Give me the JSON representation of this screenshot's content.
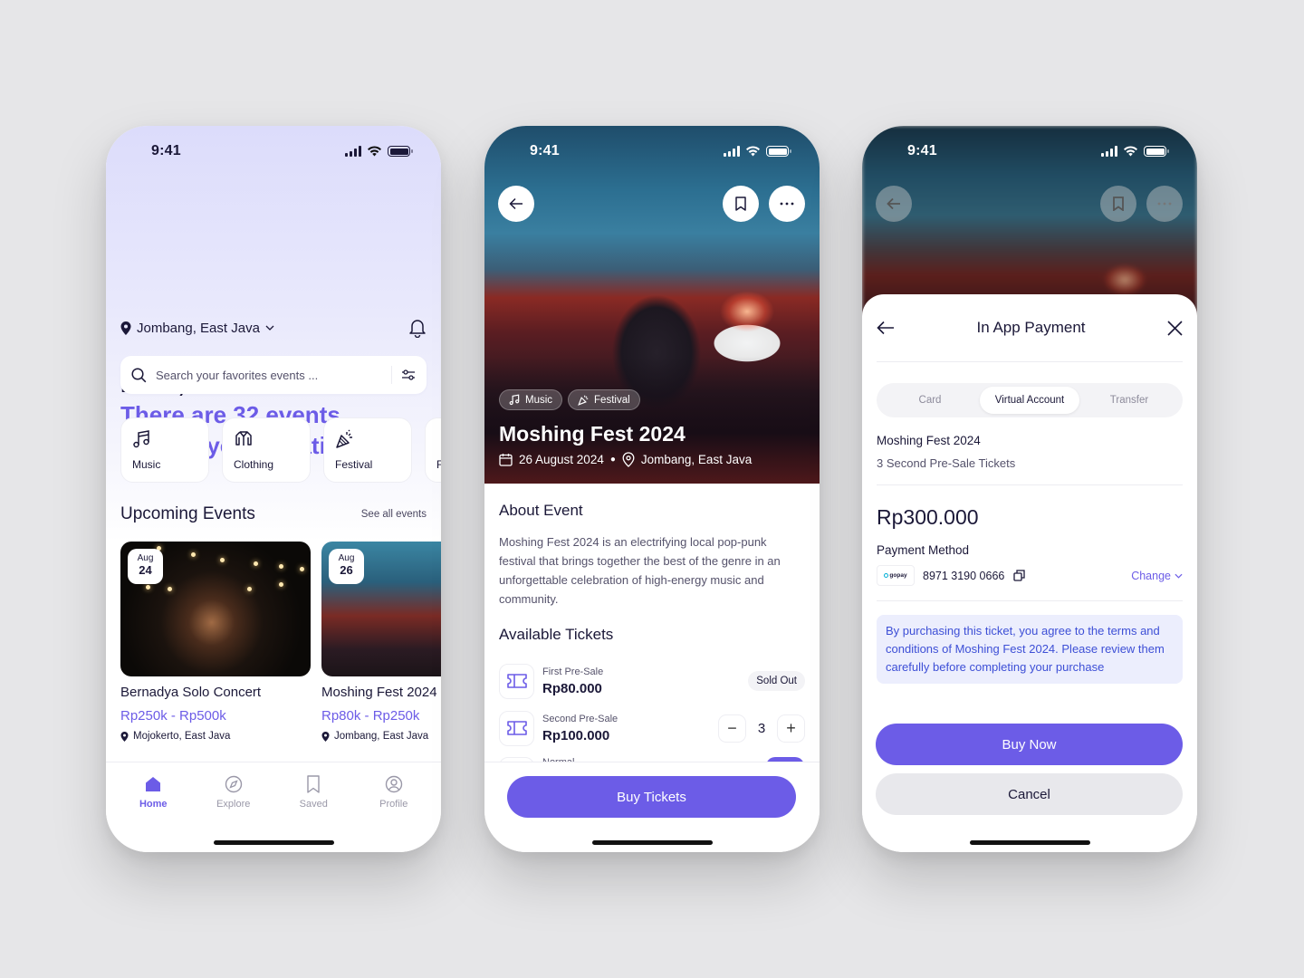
{
  "status_bar": {
    "time": "9:41"
  },
  "home": {
    "location": "Jombang, East Java",
    "greeting": "Hello, Sasmita",
    "subtitle_line1": "There are 32 events",
    "subtitle_line2": "around your location.",
    "search": {
      "placeholder": "Search your favorites events ..."
    },
    "categories": [
      {
        "label": "Music",
        "icon": "music-note-icon"
      },
      {
        "label": "Clothing",
        "icon": "jacket-icon"
      },
      {
        "label": "Festival",
        "icon": "party-popper-icon"
      },
      {
        "label": "Fo",
        "icon": "fork-icon"
      }
    ],
    "upcoming": {
      "title": "Upcoming Events",
      "see_all": "See all events",
      "events": [
        {
          "month": "Aug",
          "day": "24",
          "title": "Bernadya Solo Concert",
          "price": "Rp250k - Rp500k",
          "location": "Mojokerto, East Java"
        },
        {
          "month": "Aug",
          "day": "26",
          "title": "Moshing Fest 2024",
          "price": "Rp80k - Rp250k",
          "location": "Jombang, East Java"
        }
      ]
    },
    "tabbar": [
      {
        "label": "Home",
        "icon": "home-icon",
        "active": true
      },
      {
        "label": "Explore",
        "icon": "compass-icon"
      },
      {
        "label": "Saved",
        "icon": "bookmark-icon"
      },
      {
        "label": "Profile",
        "icon": "profile-icon"
      }
    ]
  },
  "detail": {
    "tags": [
      "Music",
      "Festival"
    ],
    "title": "Moshing Fest 2024",
    "date": "26 August 2024",
    "location": "Jombang, East Java",
    "about_title": "About Event",
    "about_text": "Moshing Fest 2024 is an electrifying local pop-punk festival that brings together the best of the genre in an unforgettable celebration of high-energy music and community.",
    "tickets_title": "Available Tickets",
    "tickets": [
      {
        "name": "First Pre-Sale",
        "price": "Rp80.000",
        "status": "Sold Out"
      },
      {
        "name": "Second Pre-Sale",
        "price": "Rp100.000",
        "quantity": "3"
      },
      {
        "name": "Normal"
      }
    ],
    "buy_button": "Buy Tickets"
  },
  "payment": {
    "title": "In App Payment",
    "tabs": [
      {
        "label": "Card"
      },
      {
        "label": "Virtual Account",
        "active": true
      },
      {
        "label": "Transfer"
      }
    ],
    "event_name": "Moshing Fest 2024",
    "ticket_summary": "3 Second Pre-Sale Tickets",
    "amount": "Rp300.000",
    "method_label": "Payment Method",
    "method_brand": "gopay",
    "account_number": "8971 3190 0666",
    "change_label": "Change",
    "notice": "By purchasing this ticket, you agree to the terms and conditions of Moshing Fest 2024. Please review them carefully before completing your purchase",
    "buy_now": "Buy Now",
    "cancel": "Cancel"
  },
  "colors": {
    "accent": "#6c5ce7",
    "text": "#1b1838",
    "notice_bg": "#eceefd",
    "notice_text": "#3d4fd6"
  }
}
